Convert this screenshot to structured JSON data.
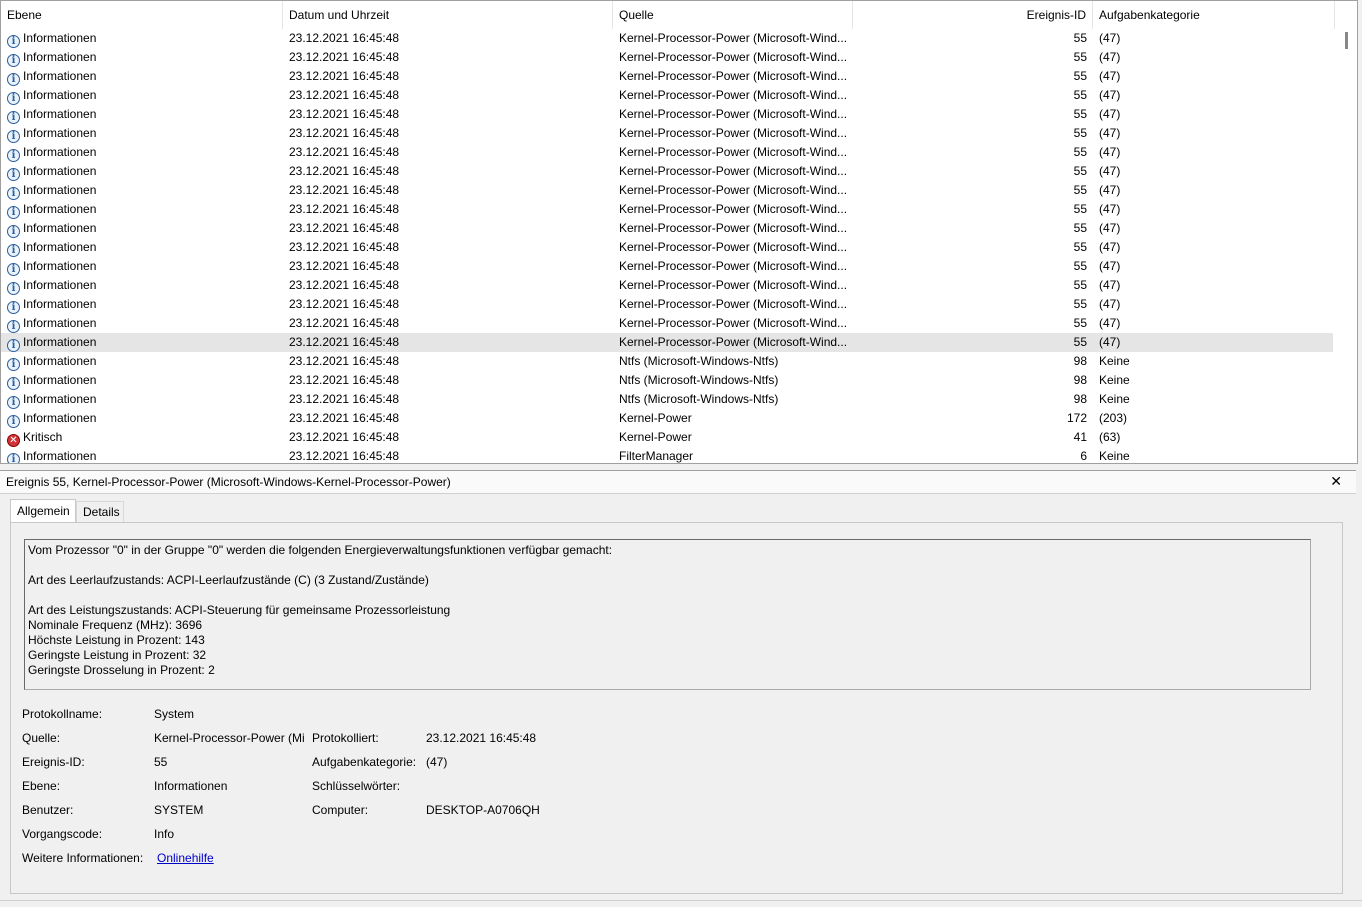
{
  "list": {
    "columns": [
      "Ebene",
      "Datum und Uhrzeit",
      "Quelle",
      "Ereignis-ID",
      "Aufgabenkategorie"
    ],
    "rows": [
      {
        "level": "Informationen",
        "icon": "info-icon",
        "date": "23.12.2021 16:45:48",
        "source": "Kernel-Processor-Power (Microsoft-Wind...",
        "id": "55",
        "task": "(47)"
      },
      {
        "level": "Informationen",
        "icon": "info-icon",
        "date": "23.12.2021 16:45:48",
        "source": "Kernel-Processor-Power (Microsoft-Wind...",
        "id": "55",
        "task": "(47)"
      },
      {
        "level": "Informationen",
        "icon": "info-icon",
        "date": "23.12.2021 16:45:48",
        "source": "Kernel-Processor-Power (Microsoft-Wind...",
        "id": "55",
        "task": "(47)"
      },
      {
        "level": "Informationen",
        "icon": "info-icon",
        "date": "23.12.2021 16:45:48",
        "source": "Kernel-Processor-Power (Microsoft-Wind...",
        "id": "55",
        "task": "(47)"
      },
      {
        "level": "Informationen",
        "icon": "info-icon",
        "date": "23.12.2021 16:45:48",
        "source": "Kernel-Processor-Power (Microsoft-Wind...",
        "id": "55",
        "task": "(47)"
      },
      {
        "level": "Informationen",
        "icon": "info-icon",
        "date": "23.12.2021 16:45:48",
        "source": "Kernel-Processor-Power (Microsoft-Wind...",
        "id": "55",
        "task": "(47)"
      },
      {
        "level": "Informationen",
        "icon": "info-icon",
        "date": "23.12.2021 16:45:48",
        "source": "Kernel-Processor-Power (Microsoft-Wind...",
        "id": "55",
        "task": "(47)"
      },
      {
        "level": "Informationen",
        "icon": "info-icon",
        "date": "23.12.2021 16:45:48",
        "source": "Kernel-Processor-Power (Microsoft-Wind...",
        "id": "55",
        "task": "(47)"
      },
      {
        "level": "Informationen",
        "icon": "info-icon",
        "date": "23.12.2021 16:45:48",
        "source": "Kernel-Processor-Power (Microsoft-Wind...",
        "id": "55",
        "task": "(47)"
      },
      {
        "level": "Informationen",
        "icon": "info-icon",
        "date": "23.12.2021 16:45:48",
        "source": "Kernel-Processor-Power (Microsoft-Wind...",
        "id": "55",
        "task": "(47)"
      },
      {
        "level": "Informationen",
        "icon": "info-icon",
        "date": "23.12.2021 16:45:48",
        "source": "Kernel-Processor-Power (Microsoft-Wind...",
        "id": "55",
        "task": "(47)"
      },
      {
        "level": "Informationen",
        "icon": "info-icon",
        "date": "23.12.2021 16:45:48",
        "source": "Kernel-Processor-Power (Microsoft-Wind...",
        "id": "55",
        "task": "(47)"
      },
      {
        "level": "Informationen",
        "icon": "info-icon",
        "date": "23.12.2021 16:45:48",
        "source": "Kernel-Processor-Power (Microsoft-Wind...",
        "id": "55",
        "task": "(47)"
      },
      {
        "level": "Informationen",
        "icon": "info-icon",
        "date": "23.12.2021 16:45:48",
        "source": "Kernel-Processor-Power (Microsoft-Wind...",
        "id": "55",
        "task": "(47)"
      },
      {
        "level": "Informationen",
        "icon": "info-icon",
        "date": "23.12.2021 16:45:48",
        "source": "Kernel-Processor-Power (Microsoft-Wind...",
        "id": "55",
        "task": "(47)"
      },
      {
        "level": "Informationen",
        "icon": "info-icon",
        "date": "23.12.2021 16:45:48",
        "source": "Kernel-Processor-Power (Microsoft-Wind...",
        "id": "55",
        "task": "(47)"
      },
      {
        "level": "Informationen",
        "icon": "info-icon",
        "date": "23.12.2021 16:45:48",
        "source": "Kernel-Processor-Power (Microsoft-Wind...",
        "id": "55",
        "task": "(47)",
        "selected": true
      },
      {
        "level": "Informationen",
        "icon": "info-icon",
        "date": "23.12.2021 16:45:48",
        "source": "Ntfs (Microsoft-Windows-Ntfs)",
        "id": "98",
        "task": "Keine"
      },
      {
        "level": "Informationen",
        "icon": "info-icon",
        "date": "23.12.2021 16:45:48",
        "source": "Ntfs (Microsoft-Windows-Ntfs)",
        "id": "98",
        "task": "Keine"
      },
      {
        "level": "Informationen",
        "icon": "info-icon",
        "date": "23.12.2021 16:45:48",
        "source": "Ntfs (Microsoft-Windows-Ntfs)",
        "id": "98",
        "task": "Keine"
      },
      {
        "level": "Informationen",
        "icon": "info-icon",
        "date": "23.12.2021 16:45:48",
        "source": "Kernel-Power",
        "id": "172",
        "task": "(203)"
      },
      {
        "level": "Kritisch",
        "icon": "critical-icon",
        "date": "23.12.2021 16:45:48",
        "source": "Kernel-Power",
        "id": "41",
        "task": "(63)"
      },
      {
        "level": "Informationen",
        "icon": "info-icon",
        "date": "23.12.2021 16:45:48",
        "source": "FilterManager",
        "id": "6",
        "task": "Keine"
      }
    ]
  },
  "detail": {
    "title": "Ereignis 55, Kernel-Processor-Power (Microsoft-Windows-Kernel-Processor-Power)",
    "close": "✕",
    "tabs": [
      "Allgemein",
      "Details"
    ],
    "description": "Vom Prozessor \"0\" in der Gruppe \"0\" werden die folgenden Energieverwaltungsfunktionen verfügbar gemacht:\n\nArt des Leerlaufzustands: ACPI-Leerlaufzustände (C) (3 Zustand/Zustände)\n\nArt des Leistungszustands: ACPI-Steuerung für gemeinsame Prozessorleistung\nNominale Frequenz (MHz): 3696\nHöchste Leistung in Prozent: 143\nGeringste Leistung in Prozent: 32\nGeringste Drosselung in Prozent: 2",
    "fields": {
      "log_label": "Protokollname:",
      "log_value": "System",
      "source_label": "Quelle:",
      "source_value": "Kernel-Processor-Power (Mi",
      "logged_label": "Protokolliert:",
      "logged_value": "23.12.2021 16:45:48",
      "id_label": "Ereignis-ID:",
      "id_value": "55",
      "task_label": "Aufgabenkategorie:",
      "task_value": "(47)",
      "level_label": "Ebene:",
      "level_value": "Informationen",
      "keywords_label": "Schlüsselwörter:",
      "keywords_value": "",
      "user_label": "Benutzer:",
      "user_value": "SYSTEM",
      "computer_label": "Computer:",
      "computer_value": "DESKTOP-A0706QH",
      "opcode_label": "Vorgangscode:",
      "opcode_value": "Info",
      "more_label": "Weitere Informationen:",
      "more_link": "Onlinehilfe"
    }
  }
}
